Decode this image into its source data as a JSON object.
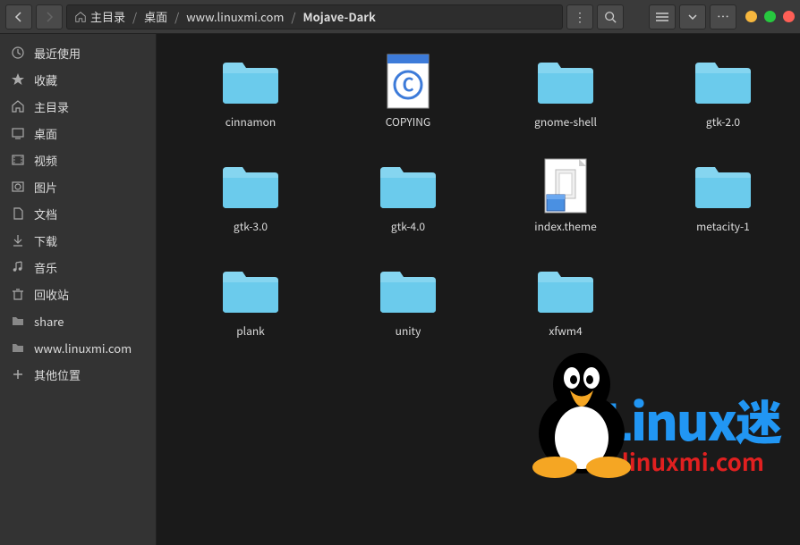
{
  "breadcrumb": [
    {
      "label": "主目录"
    },
    {
      "label": "桌面"
    },
    {
      "label": "www.linuxmi.com"
    },
    {
      "label": "Mojave-Dark"
    }
  ],
  "sidebar": {
    "items": [
      {
        "label": "最近使用",
        "icon": "clock"
      },
      {
        "label": "收藏",
        "icon": "star"
      },
      {
        "label": "主目录",
        "icon": "home"
      },
      {
        "label": "桌面",
        "icon": "desktop"
      },
      {
        "label": "视频",
        "icon": "video"
      },
      {
        "label": "图片",
        "icon": "pictures"
      },
      {
        "label": "文档",
        "icon": "documents"
      },
      {
        "label": "下载",
        "icon": "download"
      },
      {
        "label": "音乐",
        "icon": "music"
      },
      {
        "label": "回收站",
        "icon": "trash"
      },
      {
        "label": "share",
        "icon": "folder"
      },
      {
        "label": "www.linuxmi.com",
        "icon": "folder"
      },
      {
        "label": "其他位置",
        "icon": "plus"
      }
    ]
  },
  "files": [
    {
      "name": "cinnamon",
      "type": "folder"
    },
    {
      "name": "COPYING",
      "type": "copyright"
    },
    {
      "name": "gnome-shell",
      "type": "folder"
    },
    {
      "name": "gtk-2.0",
      "type": "folder"
    },
    {
      "name": "gtk-3.0",
      "type": "folder"
    },
    {
      "name": "gtk-4.0",
      "type": "folder"
    },
    {
      "name": "index.theme",
      "type": "theme"
    },
    {
      "name": "metacity-1",
      "type": "folder"
    },
    {
      "name": "plank",
      "type": "folder"
    },
    {
      "name": "unity",
      "type": "folder"
    },
    {
      "name": "xfwm4",
      "type": "folder"
    }
  ],
  "watermark": {
    "text": "Linux",
    "cn": "迷",
    "url": "www.linuxmi.com"
  }
}
